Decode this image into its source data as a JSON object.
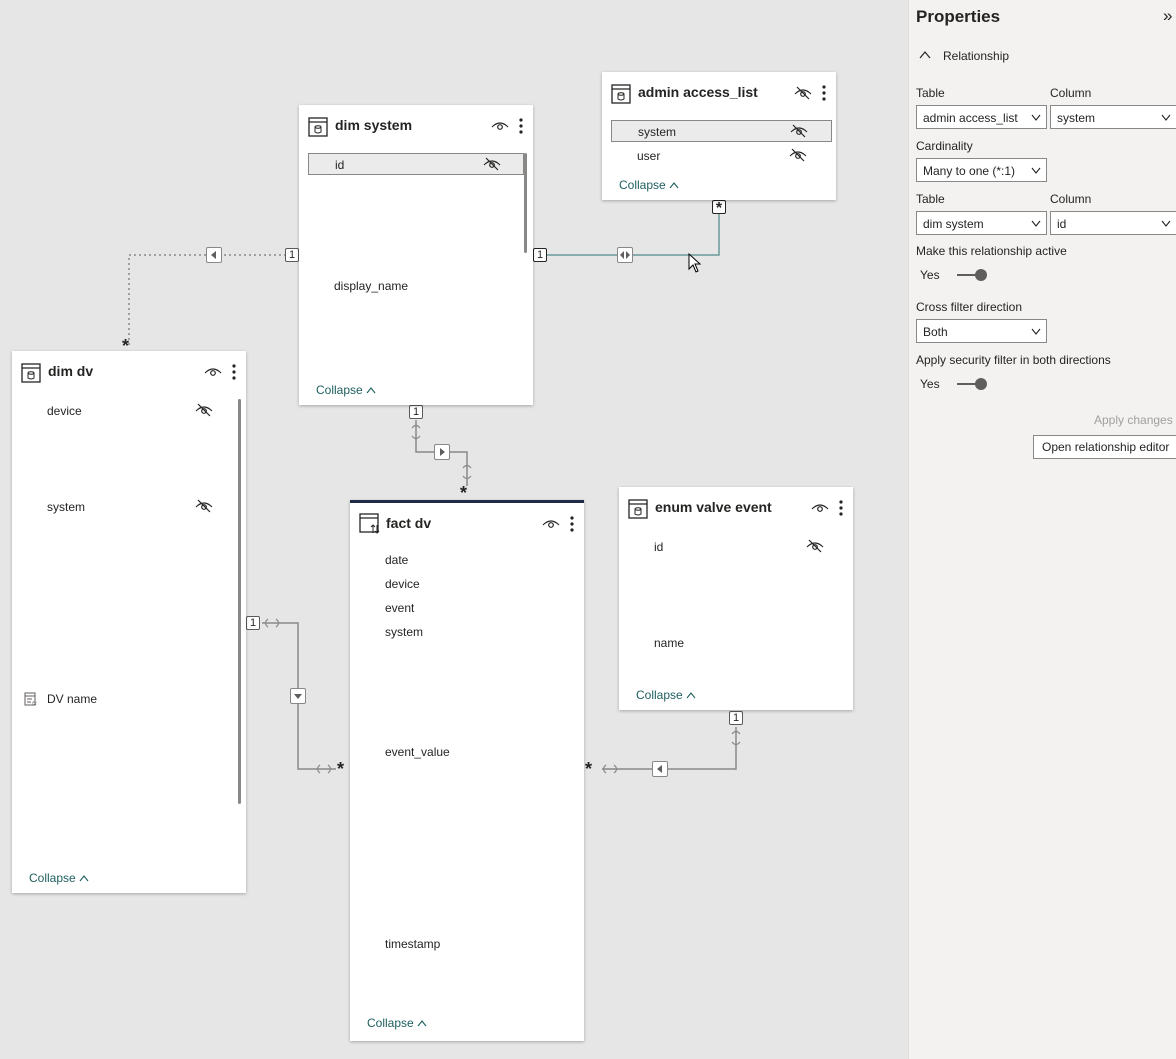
{
  "tables": {
    "dim_system": {
      "title": "dim system",
      "fields": [
        "id",
        "display_name"
      ],
      "collapse": "Collapse"
    },
    "admin_access_list": {
      "title": "admin access_list",
      "fields": [
        "system",
        "user"
      ],
      "collapse": "Collapse"
    },
    "dim_dv": {
      "title": "dim dv",
      "fields": [
        "device",
        "system",
        "DV name"
      ],
      "collapse": "Collapse"
    },
    "fact_dv": {
      "title": "fact dv",
      "fields": [
        "date",
        "device",
        "event",
        "system",
        "event_value",
        "timestamp"
      ],
      "collapse": "Collapse"
    },
    "enum_valve_event": {
      "title": "enum valve event",
      "fields": [
        "id",
        "name"
      ],
      "collapse": "Collapse"
    }
  },
  "relationships": {
    "one": "1",
    "many": "*"
  },
  "properties": {
    "title": "Properties",
    "close_glyph": "»",
    "section": "Relationship",
    "table_label": "Table",
    "column_label": "Column",
    "table1": "admin access_list",
    "column1": "system",
    "cardinality_label": "Cardinality",
    "cardinality": "Many to one (*:1)",
    "table2": "dim system",
    "column2": "id",
    "active_label": "Make this relationship active",
    "active_value": "Yes",
    "cross_filter_label": "Cross filter direction",
    "cross_filter": "Both",
    "security_label": "Apply security filter in both directions",
    "security_value": "Yes",
    "apply_changes": "Apply changes",
    "open_editor": "Open relationship editor"
  },
  "colors": {
    "canvas": "#e6e6e6",
    "active_relationship": "#6a9a98",
    "selected_table_bar": "#1f2a44",
    "collapse_link": "#1f5f5f"
  }
}
